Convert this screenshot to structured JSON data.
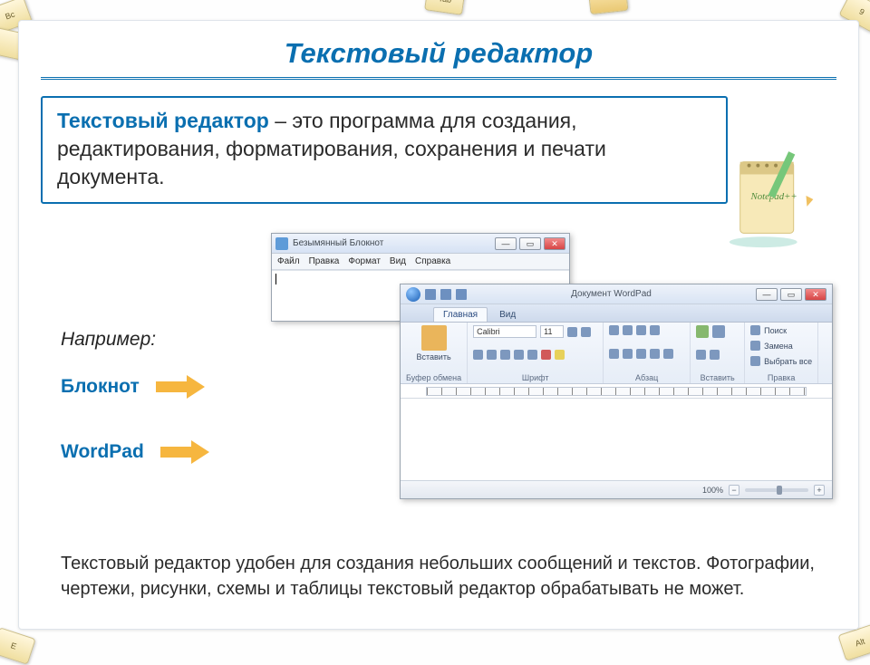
{
  "title": "Текстовый редактор",
  "definition": {
    "term": "Текстовый редактор",
    "rest": " – это программа для создания, редактирования, форматирования, сохранения и печати документа."
  },
  "examples_label": "Например:",
  "apps": {
    "notepad": "Блокнот",
    "wordpad": "WordPad"
  },
  "footnote": "Текстовый редактор удобен для создания небольших сообщений и текстов. Фотографии, чертежи, рисунки, схемы и таблицы текстовый редактор обрабатывать не может.",
  "notepad_win": {
    "title": "Безымянный   Блокнот",
    "menu": [
      "Файл",
      "Правка",
      "Формат",
      "Вид",
      "Справка"
    ],
    "btn_min": "—",
    "btn_max": "▭",
    "btn_close": "✕"
  },
  "wordpad_win": {
    "qat_title": "Документ   WordPad",
    "tabs": {
      "home": "Главная",
      "view": "Вид"
    },
    "groups": {
      "clipboard": "Буфер обмена",
      "font": "Шрифт",
      "paragraph": "Абзац",
      "insert": "Вставить",
      "editing": "Правка"
    },
    "paste": "Вставить",
    "font_name": "Calibri",
    "font_size": "11",
    "find": "Поиск",
    "replace": "Замена",
    "select_all": "Выбрать все",
    "zoom": "100%",
    "btn_min": "—",
    "btn_max": "▭",
    "btn_close": "✕"
  },
  "notepad_plus_label": "Notepad++",
  "keycaps": {
    "k1": "Bс",
    "k2": "Tab",
    "k3": "9",
    "k4": "E",
    "k5": "Alt"
  }
}
